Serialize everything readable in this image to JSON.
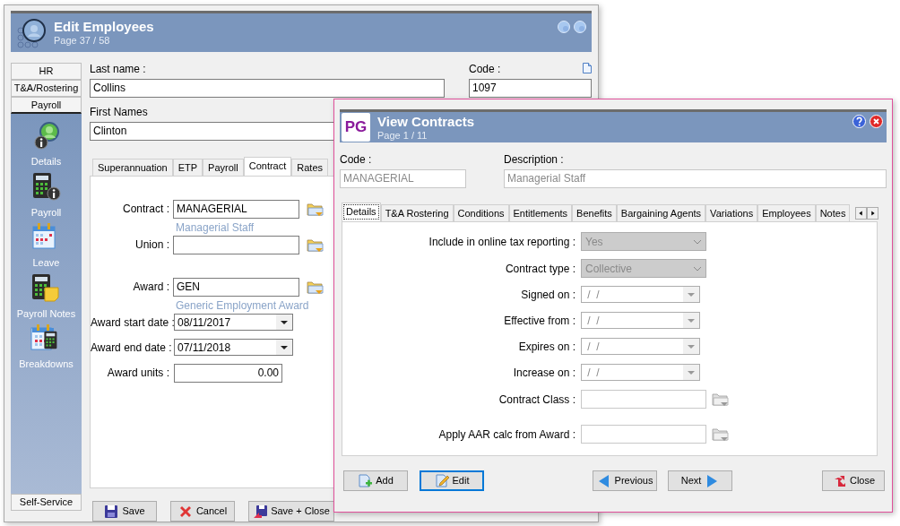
{
  "back_window": {
    "title": "Edit Employees",
    "subtitle": "Page 37 / 58",
    "sidebar": {
      "sections": [
        {
          "label": "HR",
          "selected": false
        },
        {
          "label": "T&A/Rostering",
          "selected": false
        },
        {
          "label": "Payroll",
          "selected": true
        }
      ],
      "items": [
        {
          "kind": "details",
          "label": "Details"
        },
        {
          "kind": "payroll",
          "label": "Payroll"
        },
        {
          "kind": "leave",
          "label": "Leave"
        },
        {
          "kind": "notes",
          "label": "Payroll Notes"
        },
        {
          "kind": "breakdowns",
          "label": "Breakdowns"
        }
      ],
      "footer": "Self-Service"
    },
    "last_name": {
      "label": "Last name :",
      "value": "Collins"
    },
    "code": {
      "label": "Code :",
      "value": "1097"
    },
    "first_names": {
      "label": "First Names",
      "value": "Clinton"
    },
    "tabs": [
      {
        "label": "Superannuation",
        "selected": false
      },
      {
        "label": "ETP",
        "selected": false
      },
      {
        "label": "Payroll",
        "selected": false
      },
      {
        "label": "Contract",
        "selected": true
      },
      {
        "label": "Rates",
        "selected": false
      }
    ],
    "contract_fields": [
      {
        "kind": "lookup",
        "label": "Contract :",
        "value": "MANAGERIAL",
        "note": "Managerial Staff"
      },
      {
        "kind": "lookup",
        "label": "Union :"
      },
      {
        "kind": "lookup",
        "label": "Award :",
        "value": "GEN",
        "note": "Generic Employment Award"
      },
      {
        "kind": "date",
        "label": "Award start date :",
        "value": "08/11/2017"
      },
      {
        "kind": "date",
        "label": "Award end date :",
        "value": "07/11/2018"
      },
      {
        "kind": "number",
        "label": "Award units :",
        "value": "0.00"
      }
    ],
    "buttons": [
      {
        "kind": "save",
        "label": "Save"
      },
      {
        "kind": "cancel",
        "label": "Cancel"
      },
      {
        "kind": "save-close",
        "label": "Save + Close"
      }
    ]
  },
  "dialog": {
    "title": "View Contracts",
    "subtitle": "Page 1 / 11",
    "logo": "PG",
    "code": {
      "label": "Code :",
      "value": "MANAGERIAL",
      "disabled": true
    },
    "description": {
      "label": "Description :",
      "value": "Managerial Staff",
      "disabled": true
    },
    "tabs": [
      {
        "label": "Details",
        "selected": true
      },
      {
        "label": "T&A Rostering",
        "selected": false
      },
      {
        "label": "Conditions",
        "selected": false
      },
      {
        "label": "Entitlements",
        "selected": false
      },
      {
        "label": "Benefits",
        "selected": false
      },
      {
        "label": "Bargaining Agents",
        "selected": false
      },
      {
        "label": "Variations",
        "selected": false
      },
      {
        "label": "Employees",
        "selected": false
      },
      {
        "label": "Notes",
        "selected": false
      }
    ],
    "fields": [
      {
        "kind": "select",
        "label": "Include in online tax reporting :",
        "value": "Yes",
        "disabled": true
      },
      {
        "kind": "select",
        "label": "Contract type :",
        "value": "Collective",
        "disabled": true
      },
      {
        "kind": "date",
        "label": "Signed on :",
        "value": " /  /"
      },
      {
        "kind": "date",
        "label": "Effective from :",
        "value": " /  /"
      },
      {
        "kind": "date",
        "label": "Expires on :",
        "value": " /  /"
      },
      {
        "kind": "date",
        "label": "Increase on :",
        "value": " /  /"
      },
      {
        "kind": "lookup",
        "label": "Contract Class :"
      },
      {
        "kind": "lookup",
        "label": "Apply AAR calc from Award :"
      }
    ],
    "buttons": [
      {
        "kind": "add",
        "label": "Add",
        "focused": false
      },
      {
        "kind": "edit",
        "label": "Edit",
        "focused": true
      },
      {
        "kind": "previous",
        "label": "Previous",
        "focused": false
      },
      {
        "kind": "next",
        "label": "Next",
        "focused": false
      },
      {
        "kind": "close",
        "label": "Close",
        "focused": false
      }
    ]
  }
}
